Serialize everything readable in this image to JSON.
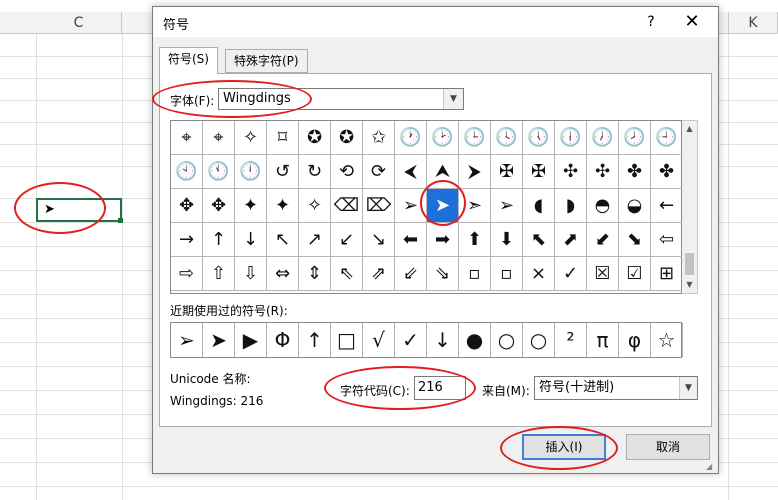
{
  "spreadsheet": {
    "columns": [
      {
        "label": "C"
      },
      {
        "label": "K"
      }
    ],
    "selected_cell_glyph": "➤",
    "accent": "#217346"
  },
  "dialog": {
    "title": "符号",
    "help_label": "?",
    "close_label": "✕",
    "tabs": [
      {
        "label": "符号(S)",
        "active": true
      },
      {
        "label": "特殊字符(P)",
        "active": false
      }
    ],
    "font": {
      "label": "字体(F):",
      "value": "Wingdings"
    },
    "symbols": [
      [
        "⌖",
        "⌖",
        "✧",
        "⌑",
        "✪",
        "✪",
        "✩",
        "🕐",
        "🕑",
        "🕒",
        "🕓",
        "🕔",
        "🕕",
        "🕖",
        "🕗",
        "🕘"
      ],
      [
        "🕙",
        "🕚",
        "🕛",
        "↺",
        "↻",
        "⟲",
        "⟳",
        "⮜",
        "⮝",
        "⮞",
        "✠",
        "✠",
        "✣",
        "✣",
        "✤",
        "✤"
      ],
      [
        "✥",
        "✥",
        "✦",
        "✦",
        "✧",
        "⌫",
        "⌦",
        "➢",
        "➤",
        "➣",
        "➢",
        "◖",
        "◗",
        "◓",
        "◒",
        "←"
      ],
      [
        "→",
        "↑",
        "↓",
        "↖",
        "↗",
        "↙",
        "↘",
        "⬅",
        "➡",
        "⬆",
        "⬇",
        "⬉",
        "⬈",
        "⬋",
        "⬊",
        "⇦"
      ],
      [
        "⇨",
        "⇧",
        "⇩",
        "⇔",
        "⇕",
        "⇖",
        "⇗",
        "⇙",
        "⇘",
        "▫",
        "▫",
        "×",
        "✓",
        "☒",
        "☑",
        "⊞"
      ]
    ],
    "selected_symbol": {
      "row": 2,
      "col": 8
    },
    "recent": {
      "label": "近期使用过的符号(R):",
      "items": [
        "➢",
        "➤",
        "▶",
        "Φ",
        "↑",
        "□",
        "√",
        "✓",
        "↓",
        "●",
        "○",
        "○",
        "²",
        "π",
        "φ",
        "☆"
      ]
    },
    "unicode_name_label": "Unicode 名称:",
    "unicode_name_value": "Wingdings: 216",
    "char_code": {
      "label": "字符代码(C):",
      "value": "216"
    },
    "from": {
      "label": "来自(M):",
      "value": "符号(十进制)"
    },
    "insert_button": "插入(I)",
    "cancel_button": "取消",
    "selection_color": "#1e6fd9",
    "annotation_color": "#e02020"
  }
}
